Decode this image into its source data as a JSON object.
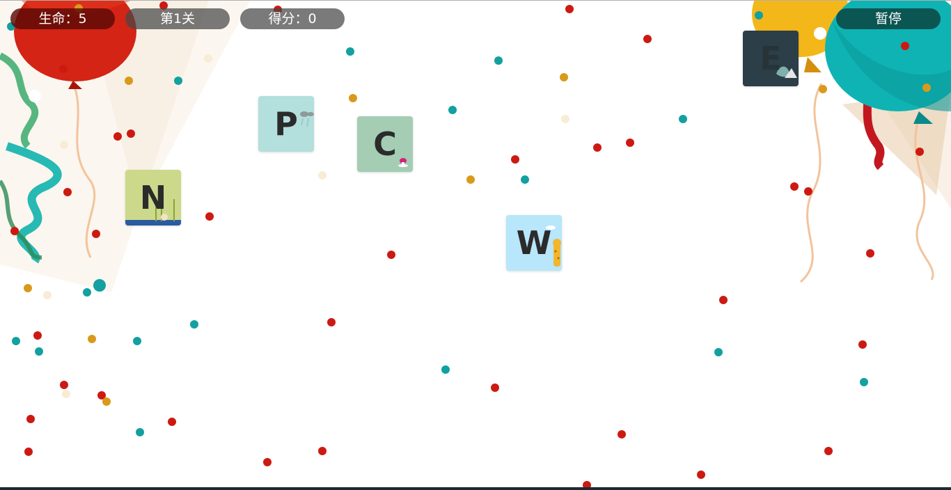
{
  "hud": {
    "lives_label": "生命：5",
    "level_label": "第1关",
    "score_label": "得分：0",
    "pause_label": "暂停"
  },
  "tiles": [
    {
      "letter": "P",
      "bg": "#b3dfdc",
      "deco": "cloud-icon"
    },
    {
      "letter": "C",
      "bg": "#a4cdb4",
      "deco": "mushroom-icon"
    },
    {
      "letter": "N",
      "bg": "#ccd98a",
      "deco": "bamboo-icon"
    },
    {
      "letter": "W",
      "bg": "#b8e6fa",
      "deco": "giraffe-icon"
    },
    {
      "letter": "E",
      "bg": "#2c3e47",
      "deco": "whale-icon"
    }
  ],
  "colors": {
    "confetti_red": "#cc1a12",
    "confetti_teal": "#13a0a0",
    "confetti_gold": "#d99a1b",
    "confetti_cream": "#f8ecd5",
    "balloon_red": "#d42415",
    "balloon_yellow": "#f4b71a",
    "balloon_teal": "#0fb3b3"
  }
}
